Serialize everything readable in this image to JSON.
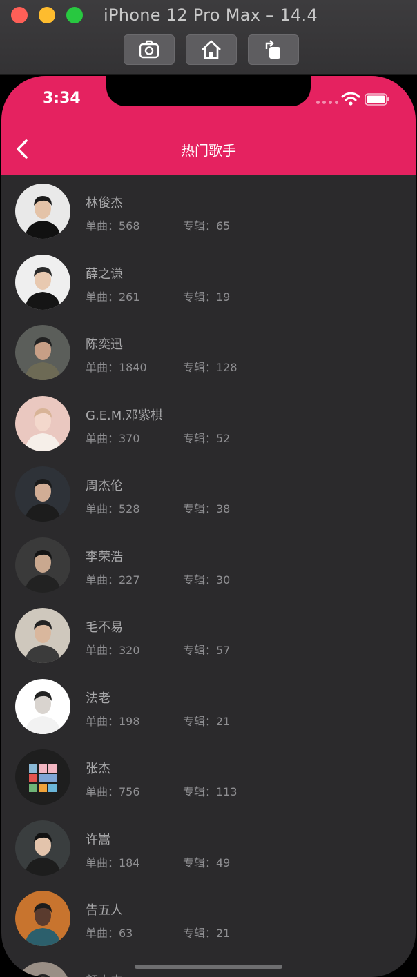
{
  "simulator": {
    "title": "iPhone 12 Pro Max – 14.4",
    "buttons": [
      "screenshot-icon",
      "home-icon",
      "rotate-icon"
    ]
  },
  "status_bar": {
    "time": "3:34"
  },
  "nav": {
    "title": "热门歌手"
  },
  "colors": {
    "accent": "#e52260",
    "background": "#2b2a2c"
  },
  "singers": [
    {
      "name": "林俊杰",
      "singles": "单曲：568",
      "albums": "专辑：65"
    },
    {
      "name": "薛之谦",
      "singles": "单曲：261",
      "albums": "专辑：19"
    },
    {
      "name": "陈奕迅",
      "singles": "单曲：1840",
      "albums": "专辑：128"
    },
    {
      "name": "G.E.M.邓紫棋",
      "singles": "单曲：370",
      "albums": "专辑：52"
    },
    {
      "name": "周杰伦",
      "singles": "单曲：528",
      "albums": "专辑：38"
    },
    {
      "name": "李荣浩",
      "singles": "单曲：227",
      "albums": "专辑：30"
    },
    {
      "name": "毛不易",
      "singles": "单曲：320",
      "albums": "专辑：57"
    },
    {
      "name": "法老",
      "singles": "单曲：198",
      "albums": "专辑：21"
    },
    {
      "name": "张杰",
      "singles": "单曲：756",
      "albums": "专辑：113"
    },
    {
      "name": "许嵩",
      "singles": "单曲：184",
      "albums": "专辑：49"
    },
    {
      "name": "告五人",
      "singles": "单曲：63",
      "albums": "专辑：21"
    },
    {
      "name": "颜人中",
      "singles": "",
      "albums": ""
    }
  ]
}
